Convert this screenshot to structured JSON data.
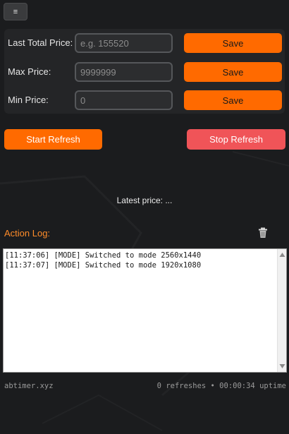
{
  "menu": {
    "icon": "hamburger-icon",
    "label": "≡"
  },
  "prices": {
    "last_total": {
      "label": "Last Total Price:",
      "value": "",
      "placeholder": "e.g. 155520",
      "save_label": "Save"
    },
    "max": {
      "label": "Max Price:",
      "value": "",
      "placeholder": "9999999",
      "save_label": "Save"
    },
    "min": {
      "label": "Min Price:",
      "value": "",
      "placeholder": "0",
      "save_label": "Save"
    }
  },
  "controls": {
    "start_label": "Start Refresh",
    "stop_label": "Stop Refresh"
  },
  "latest": {
    "label": "Latest price:",
    "value": "..."
  },
  "log": {
    "title": "Action Log:",
    "clear_icon": "trash-icon",
    "lines": [
      "[11:37:06] [MODE] Switched to mode 2560x1440",
      "[11:37:07] [MODE] Switched to mode 1920x1080"
    ]
  },
  "footer": {
    "site": "abtimer.xyz",
    "status": "0 refreshes • 00:00:34 uptime"
  },
  "colors": {
    "background": "#1b1c1e",
    "accent": "#ff6a00",
    "stop": "#f05458",
    "log_title": "#ff8c2a"
  }
}
